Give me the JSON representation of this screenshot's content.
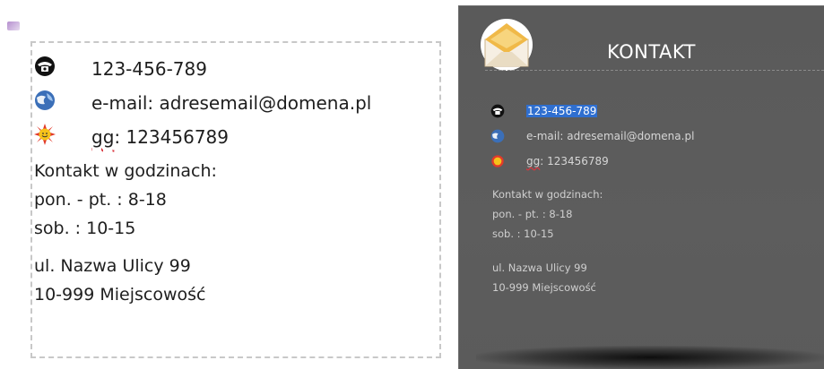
{
  "editor": {
    "phone": "123-456-789",
    "email": "e-mail: adresemail@domena.pl",
    "gg_label": "gg",
    "gg_value": ": 123456789",
    "hours_title": "Kontakt w godzinach:",
    "hours_weekdays": "pon. - pt. : 8-18",
    "hours_saturday": "sob. : 10-15",
    "street": "ul. Nazwa Ulicy 99",
    "city": "10-999 Miejscowość"
  },
  "preview": {
    "title": "KONTAKT",
    "phone": "123-456-789",
    "email": "e-mail: adresemail@domena.pl",
    "gg_label": "gg",
    "gg_value": ": 123456789",
    "hours_title": "Kontakt w godzinach:",
    "hours_weekdays": "pon. - pt. : 8-18",
    "hours_saturday": "sob. : 10-15",
    "street": "ul. Nazwa Ulicy 99",
    "city": "10-999 Miejscowość"
  },
  "icons": {
    "phone": "telephone-icon",
    "email": "email-globe-icon",
    "gg": "gadu-gadu-sun-icon",
    "header": "envelope-icon"
  },
  "colors": {
    "preview_bg": "#5a5a5a",
    "highlight": "#2f6fd0",
    "spell_underline": "#d9363e"
  }
}
